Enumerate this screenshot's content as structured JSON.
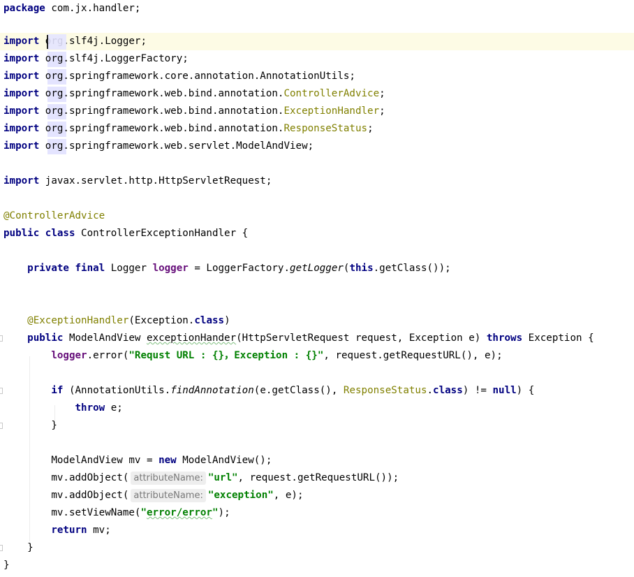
{
  "editor": {
    "package_kw": "package",
    "package_name": "com.jx.handler;",
    "import_kw": "import",
    "imports": [
      {
        "pre": "org.slf4j.Logger;",
        "ann": "",
        "post": ""
      },
      {
        "pre": "org.slf4j.LoggerFactory;",
        "ann": "",
        "post": ""
      },
      {
        "pre": "org.springframework.core.annotation.AnnotationUtils;",
        "ann": "",
        "post": ""
      },
      {
        "pre": "org.springframework.web.bind.annotation.",
        "ann": "ControllerAdvice",
        "post": ";"
      },
      {
        "pre": "org.springframework.web.bind.annotation.",
        "ann": "ExceptionHandler",
        "post": ";"
      },
      {
        "pre": "org.springframework.web.bind.annotation.",
        "ann": "ResponseStatus",
        "post": ";"
      },
      {
        "pre": "org.springframework.web.servlet.ModelAndView;",
        "ann": "",
        "post": ""
      }
    ],
    "import_servlet": "javax.servlet.http.HttpServletRequest;",
    "class_annotation": "@ControllerAdvice",
    "class_decl": {
      "kw": "public class",
      "name": "ControllerExceptionHandler {"
    },
    "logger_line": {
      "mods": "private final",
      "type": "Logger",
      "field": "logger",
      "eq": " = LoggerFactory.",
      "method": "getLogger",
      "open": "(",
      "this_kw": "this",
      "rest": ".getClass());"
    },
    "handler_annotation": {
      "ann": "@ExceptionHandler",
      "args": "(Exception.",
      "class_kw": "class",
      "close": ")"
    },
    "method_decl": {
      "kw": "public",
      "pre": "ModelAndView ",
      "name": "exceptionHander",
      "params": "(HttpServletRequest request, Exception e) ",
      "throws_kw": "throws",
      "post": " Exception {"
    },
    "log_line": {
      "field": "logger",
      "call": ".error(",
      "str": "\"Requst URL : {}，Exception : {}\"",
      "rest": ", request.getRequestURL(), e);"
    },
    "if_line": {
      "kw": "if",
      "pre": " (AnnotationUtils.",
      "method": "findAnnotation",
      "mid": "(e.getClass(), ",
      "ann": "ResponseStatus",
      "dot": ".",
      "class_kw": "class",
      "ne": ") != ",
      "null_kw": "null",
      "close": ") {"
    },
    "throw_line": {
      "kw": "throw",
      "rest": " e;"
    },
    "close_if": "}",
    "mav_line": {
      "pre": "ModelAndView mv = ",
      "new_kw": "new",
      "post": " ModelAndView();"
    },
    "add1": {
      "pre": "mv.addObject(",
      "hint": "attributeName:",
      "str": "\"url\"",
      "post": ", request.getRequestURL());"
    },
    "add2": {
      "pre": "mv.addObject(",
      "hint": "attributeName:",
      "str": "\"exception\"",
      "post": ", e);"
    },
    "view_line": {
      "pre": "mv.setViewName(",
      "str_open": "\"",
      "str_word": "error/error",
      "str_close": "\"",
      "post": ");"
    },
    "return_line": {
      "kw": "return",
      "rest": " mv;"
    },
    "close_method": "}",
    "close_class": "}"
  }
}
